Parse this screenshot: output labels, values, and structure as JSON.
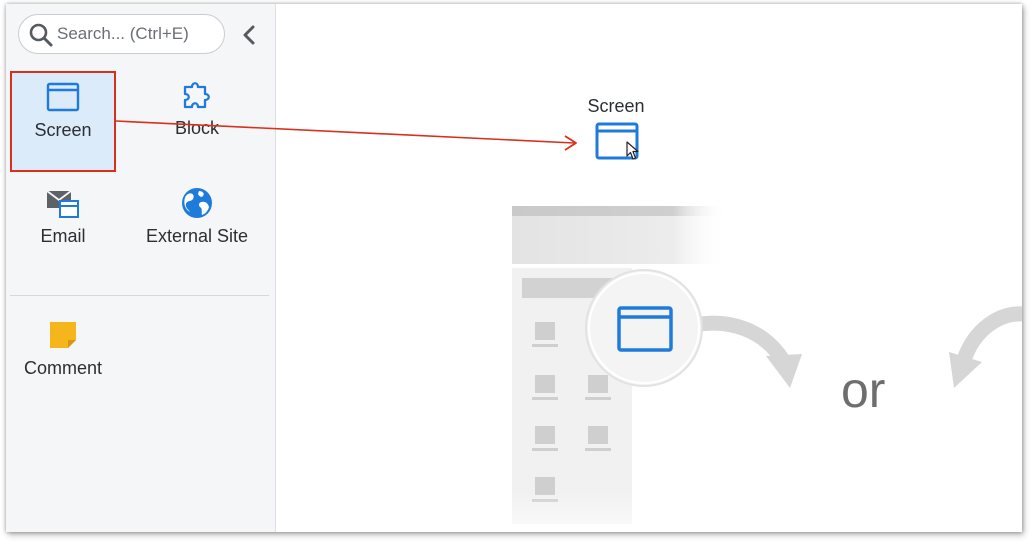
{
  "search": {
    "placeholder": "Search... (Ctrl+E)",
    "icon": "search-icon"
  },
  "sidebar": {
    "collapse_icon": "chevron-left-icon",
    "items": [
      {
        "label": "Screen",
        "icon": "screen-icon",
        "selected": true
      },
      {
        "label": "Block",
        "icon": "puzzle-icon",
        "selected": false
      },
      {
        "label": "Email",
        "icon": "email-icon",
        "selected": false
      },
      {
        "label": "External Site",
        "icon": "globe-icon",
        "selected": false
      },
      {
        "label": "Comment",
        "icon": "sticky-note-icon",
        "selected": false
      }
    ]
  },
  "canvas": {
    "drag_label": "Screen",
    "or_text": "or"
  },
  "colors": {
    "accent_blue": "#1f7bdb",
    "highlight_red": "#d9301c",
    "selected_bg": "#dcebf9",
    "sidebar_bg": "#f5f6f8",
    "comment_yellow": "#f5b51c"
  }
}
